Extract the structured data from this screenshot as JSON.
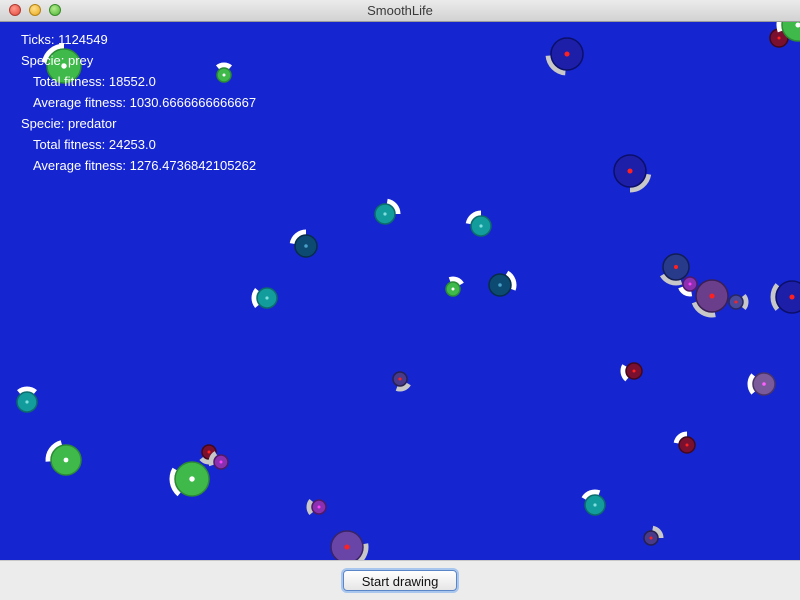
{
  "window": {
    "title": "SmoothLife"
  },
  "hud": {
    "ticks": "Ticks: 1124549",
    "specie_prey": "Specie: prey",
    "prey_total": "Total fitness: 18552.0",
    "prey_average": "Average fitness: 1030.6666666666667",
    "specie_predator": "Specie: predator",
    "predator_total": "Total fitness: 24253.0",
    "predator_average": "Average fitness: 1276.4736842105262"
  },
  "controls": {
    "start_button": "Start drawing"
  },
  "colors": {
    "background": "#1525d0",
    "prey_green": "#3fb94a",
    "prey_teal": "#129c9c",
    "predator_navy": "#1e1fa8",
    "predator_maroon": "#7a1030",
    "predator_purple": "#6a45a8"
  }
}
